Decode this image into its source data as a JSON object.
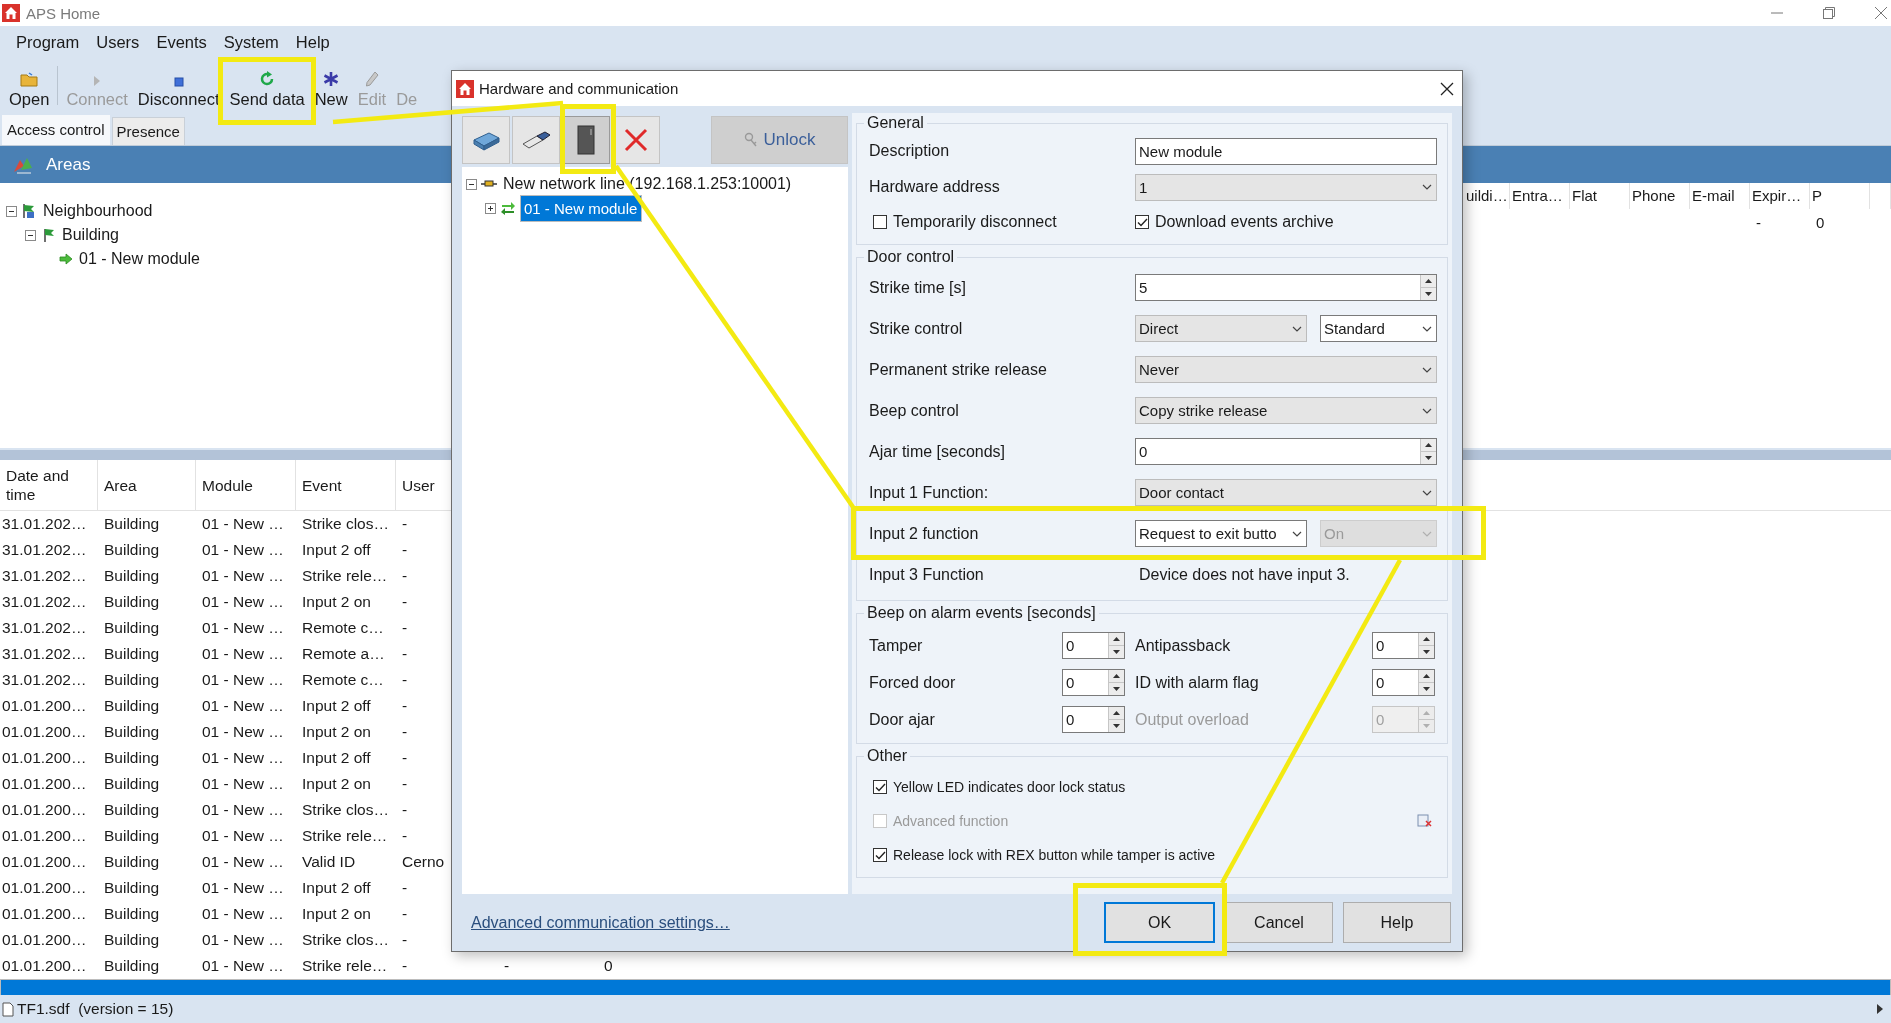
{
  "app_window": {
    "title": "APS Home"
  },
  "menu": [
    "Program",
    "Users",
    "Events",
    "System",
    "Help"
  ],
  "toolbar": [
    {
      "label": "Open",
      "disabled": false
    },
    {
      "label": "Connect",
      "disabled": true
    },
    {
      "label": "Disconnect",
      "disabled": false
    },
    {
      "label": "Send data",
      "disabled": false,
      "highlighted": true
    },
    {
      "label": "New",
      "disabled": false
    },
    {
      "label": "Edit",
      "disabled": true
    },
    {
      "label": "De",
      "disabled": true
    }
  ],
  "tabs": [
    {
      "label": "Access control",
      "selected": true
    },
    {
      "label": "Presence",
      "selected": false
    }
  ],
  "areas_panel": {
    "title": "Areas",
    "tree": [
      {
        "label": "Neighbourhood",
        "expanded": true,
        "children": [
          {
            "label": "Building",
            "expanded": true,
            "children": [
              {
                "label": "01 - New module"
              }
            ]
          }
        ]
      }
    ]
  },
  "users_table": {
    "columns": [
      "uildi…",
      "Entra…",
      "Flat",
      "Phone",
      "E-mail",
      "Expir…",
      "P"
    ],
    "rows": [
      {
        "expir": "-",
        "p": "0"
      }
    ]
  },
  "events_table": {
    "columns": [
      "Date and time",
      "Area",
      "Module",
      "Event",
      "User"
    ],
    "rows": [
      {
        "date": "31.01.202…",
        "area": "Building",
        "module": "01 - New …",
        "event": "Strike clos…",
        "user": "-"
      },
      {
        "date": "31.01.202…",
        "area": "Building",
        "module": "01 - New …",
        "event": "Input 2 off",
        "user": "-"
      },
      {
        "date": "31.01.202…",
        "area": "Building",
        "module": "01 - New …",
        "event": "Strike rele…",
        "user": "-"
      },
      {
        "date": "31.01.202…",
        "area": "Building",
        "module": "01 - New …",
        "event": "Input 2 on",
        "user": "-"
      },
      {
        "date": "31.01.202…",
        "area": "Building",
        "module": "01 - New …",
        "event": "Remote c…",
        "user": "-"
      },
      {
        "date": "31.01.202…",
        "area": "Building",
        "module": "01 - New …",
        "event": "Remote a…",
        "user": "-"
      },
      {
        "date": "31.01.202…",
        "area": "Building",
        "module": "01 - New …",
        "event": "Remote c…",
        "user": "-"
      },
      {
        "date": "01.01.200…",
        "area": "Building",
        "module": "01 - New …",
        "event": "Input 2 off",
        "user": "-"
      },
      {
        "date": "01.01.200…",
        "area": "Building",
        "module": "01 - New …",
        "event": "Input 2 on",
        "user": "-"
      },
      {
        "date": "01.01.200…",
        "area": "Building",
        "module": "01 - New …",
        "event": "Input 2 off",
        "user": "-"
      },
      {
        "date": "01.01.200…",
        "area": "Building",
        "module": "01 - New …",
        "event": "Input 2 on",
        "user": "-"
      },
      {
        "date": "01.01.200…",
        "area": "Building",
        "module": "01 - New …",
        "event": "Strike clos…",
        "user": "-"
      },
      {
        "date": "01.01.200…",
        "area": "Building",
        "module": "01 - New …",
        "event": "Strike rele…",
        "user": "-"
      },
      {
        "date": "01.01.200…",
        "area": "Building",
        "module": "01 - New …",
        "event": "Valid ID",
        "user": "Cerno"
      },
      {
        "date": "01.01.200…",
        "area": "Building",
        "module": "01 - New …",
        "event": "Input 2 off",
        "user": "-"
      },
      {
        "date": "01.01.200…",
        "area": "Building",
        "module": "01 - New …",
        "event": "Input 2 on",
        "user": "-"
      },
      {
        "date": "01.01.200…",
        "area": "Building",
        "module": "01 - New …",
        "event": "Strike clos…",
        "user": "-"
      },
      {
        "date": "01.01.200…",
        "area": "Building",
        "module": "01 - New …",
        "event": "Strike rele…",
        "user": "-",
        "extra": [
          "-",
          "0"
        ]
      }
    ],
    "partial_row": {
      "selected": true
    }
  },
  "dialog": {
    "title": "Hardware and communication",
    "toolbar_buttons": [
      {
        "selected": false
      },
      {
        "selected": false
      },
      {
        "selected": true,
        "highlighted": true
      },
      {
        "selected": false
      }
    ],
    "unlock_button": {
      "label": "Unlock"
    },
    "tree": [
      {
        "label": "New network line (192.168.1.253:10001)",
        "expanded": true,
        "selected": false,
        "children": [
          {
            "label": "01 - New module",
            "expanded": false,
            "selected": true
          }
        ]
      }
    ],
    "sections": [
      {
        "title": "General",
        "rows": [
          {
            "kind": "text",
            "label": "Description",
            "value": "New module"
          },
          {
            "kind": "select",
            "label": "Hardware address",
            "selects": [
              {
                "value": "1",
                "editable": false,
                "disabled": false
              }
            ]
          },
          {
            "kind": "checks",
            "items": [
              {
                "label": "Temporarily disconnect",
                "checked": false
              },
              {
                "label": "Download events archive",
                "checked": true
              }
            ]
          }
        ]
      },
      {
        "title": "Door control",
        "rows": [
          {
            "kind": "spin",
            "label": "Strike time [s]",
            "value": "5"
          },
          {
            "kind": "select",
            "label": "Strike control",
            "selects": [
              {
                "value": "Direct",
                "editable": false,
                "disabled": false
              },
              {
                "value": "Standard",
                "editable": true,
                "disabled": false
              }
            ]
          },
          {
            "kind": "select",
            "label": "Permanent strike release",
            "selects": [
              {
                "value": "Never",
                "editable": false,
                "disabled": false
              }
            ]
          },
          {
            "kind": "select",
            "label": "Beep control",
            "selects": [
              {
                "value": "Copy strike release",
                "editable": false,
                "disabled": false
              }
            ]
          },
          {
            "kind": "spin",
            "label": "Ajar time [seconds]",
            "value": "0"
          },
          {
            "kind": "select",
            "label": "Input 1 Function:",
            "selects": [
              {
                "value": "Door contact",
                "editable": false,
                "disabled": false
              }
            ]
          },
          {
            "kind": "select",
            "label": "Input 2 function",
            "selects": [
              {
                "value": "Request to exit butto",
                "editable": true,
                "disabled": false
              },
              {
                "value": "On",
                "editable": false,
                "disabled": true
              }
            ],
            "highlighted": true
          },
          {
            "kind": "note",
            "label": "Input 3 Function",
            "value": "Device does not have input 3."
          }
        ]
      },
      {
        "title": "Beep on alarm events [seconds]",
        "rows": [
          {
            "kind": "spin_pair",
            "pair": [
              {
                "label": "Tamper",
                "value": "0",
                "disabled": false
              },
              {
                "label": "Antipassback",
                "value": "0",
                "disabled": false
              }
            ]
          },
          {
            "kind": "spin_pair",
            "pair": [
              {
                "label": "Forced door",
                "value": "0",
                "disabled": false
              },
              {
                "label": "ID with alarm flag",
                "value": "0",
                "disabled": false
              }
            ]
          },
          {
            "kind": "spin_pair",
            "pair": [
              {
                "label": "Door ajar",
                "value": "0",
                "disabled": false
              },
              {
                "label": "Output overload",
                "value": "0",
                "disabled": true
              }
            ]
          }
        ]
      },
      {
        "title": "Other",
        "rows": [
          {
            "kind": "check",
            "label": "Yellow LED indicates door lock status",
            "checked": true,
            "disabled": false
          },
          {
            "kind": "check",
            "label": "Advanced function",
            "checked": false,
            "disabled": true
          },
          {
            "kind": "check",
            "label": "Release lock with REX button while tamper is active",
            "checked": true,
            "disabled": false
          }
        ]
      }
    ],
    "link": "Advanced communication settings…",
    "buttons": [
      {
        "label": "OK",
        "default": true,
        "highlighted": true
      },
      {
        "label": "Cancel",
        "default": false
      },
      {
        "label": "Help",
        "default": false
      }
    ]
  },
  "status_bar": {
    "text": "TF1.sdf  (version = 15)"
  }
}
